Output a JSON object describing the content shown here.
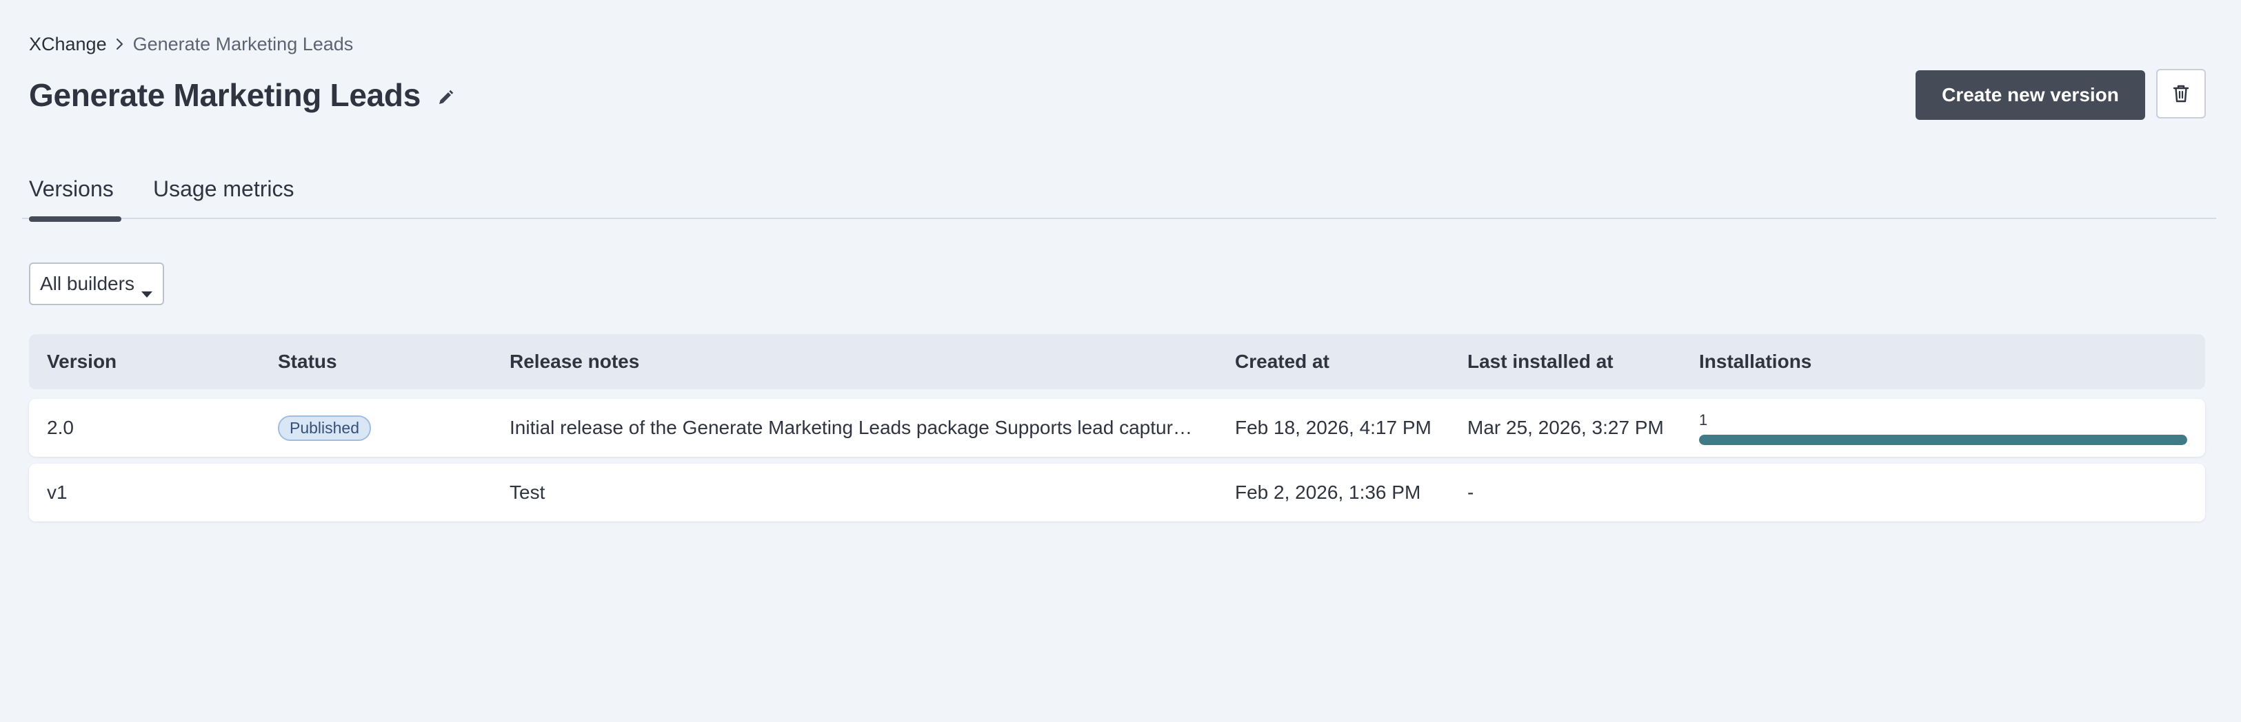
{
  "breadcrumb": {
    "root": "XChange",
    "current": "Generate Marketing Leads"
  },
  "page": {
    "title": "Generate Marketing Leads"
  },
  "actions": {
    "create_label": "Create new version",
    "delete_icon": "trash-icon",
    "edit_icon": "pencil-icon"
  },
  "tabs": [
    {
      "label": "Versions",
      "active": true
    },
    {
      "label": "Usage metrics",
      "active": false
    }
  ],
  "filter": {
    "builders_label": "All builders"
  },
  "table": {
    "headers": [
      "Version",
      "Status",
      "Release notes",
      "Created at",
      "Last installed at",
      "Installations"
    ],
    "rows": [
      {
        "version": "2.0",
        "status": "Published",
        "release_notes": "Initial release of the Generate Marketing Leads package Supports lead capture from …",
        "created_at": "Feb 18, 2026, 4:17 PM",
        "last_installed_at": "Mar 25, 2026, 3:27 PM",
        "installations": "1",
        "installations_fraction": 1.0
      },
      {
        "version": "v1",
        "status": "",
        "release_notes": "Test",
        "created_at": "Feb 2, 2026, 1:36 PM",
        "last_installed_at": "-",
        "installations": ""
      }
    ]
  },
  "colors": {
    "background": "#f1f4f9",
    "primary_button": "#454b57",
    "badge_bg": "#d9e6f6",
    "bar_fill": "#3f7a86"
  }
}
